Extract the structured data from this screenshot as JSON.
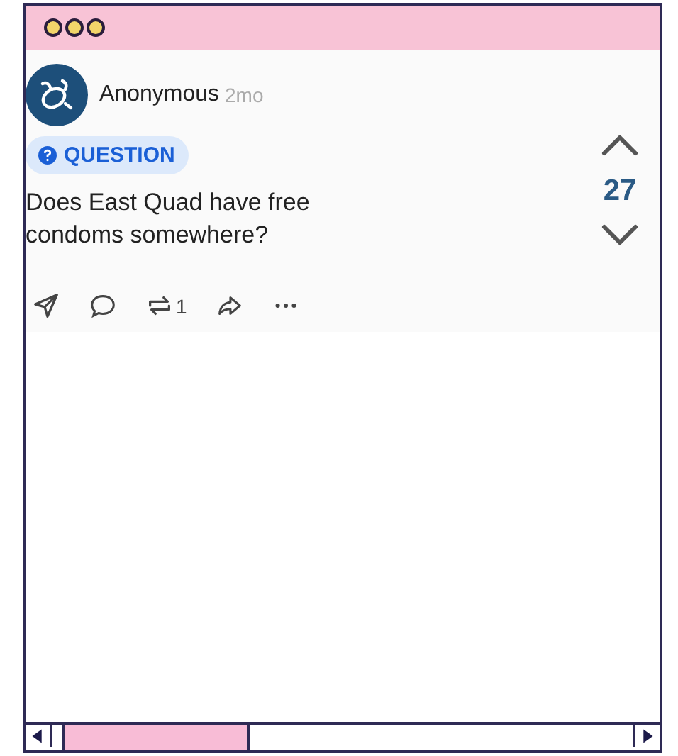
{
  "post": {
    "author": "Anonymous",
    "time": "2mo",
    "tag": "QUESTION",
    "text": "Does East Quad have free condoms somewhere?",
    "score": "27",
    "repost_count": "1"
  }
}
